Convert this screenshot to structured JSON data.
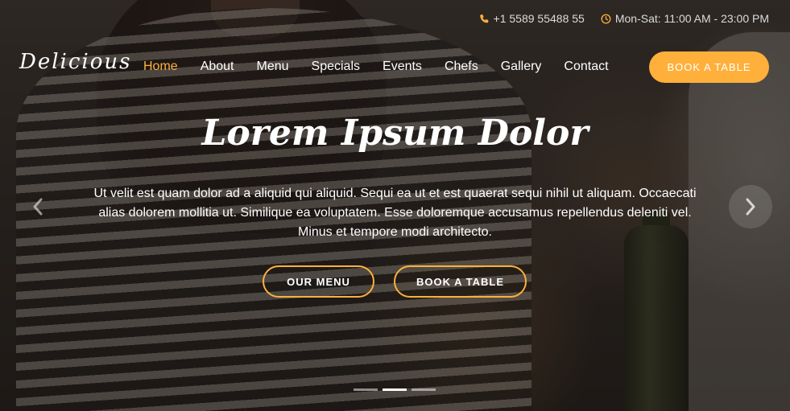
{
  "topbar": {
    "phone": "+1 5589 55488 55",
    "hours": "Mon-Sat: 11:00 AM - 23:00 PM"
  },
  "brand": {
    "logo": "Delicious"
  },
  "nav": {
    "items": [
      "Home",
      "About",
      "Menu",
      "Specials",
      "Events",
      "Chefs",
      "Gallery",
      "Contact"
    ],
    "active": "Home",
    "cta": "BOOK A TABLE"
  },
  "hero": {
    "title": "Lorem Ipsum Dolor",
    "description": "Ut velit est quam dolor ad a aliquid qui aliquid. Sequi ea ut et est quaerat sequi nihil ut aliquam. Occaecati alias dolorem mollitia ut. Similique ea voluptatem. Esse doloremque accusamus repellendus deleniti vel. Minus et tempore modi architecto.",
    "buttons": {
      "menu": "OUR MENU",
      "book": "BOOK A TABLE"
    },
    "slides": {
      "count": 3,
      "active_index": 2
    }
  },
  "colors": {
    "accent": "#ffb03b",
    "text": "#ffffff"
  },
  "icons": {
    "phone": "phone-icon",
    "clock": "clock-icon",
    "prev": "chevron-left-icon",
    "next": "chevron-right-icon"
  }
}
